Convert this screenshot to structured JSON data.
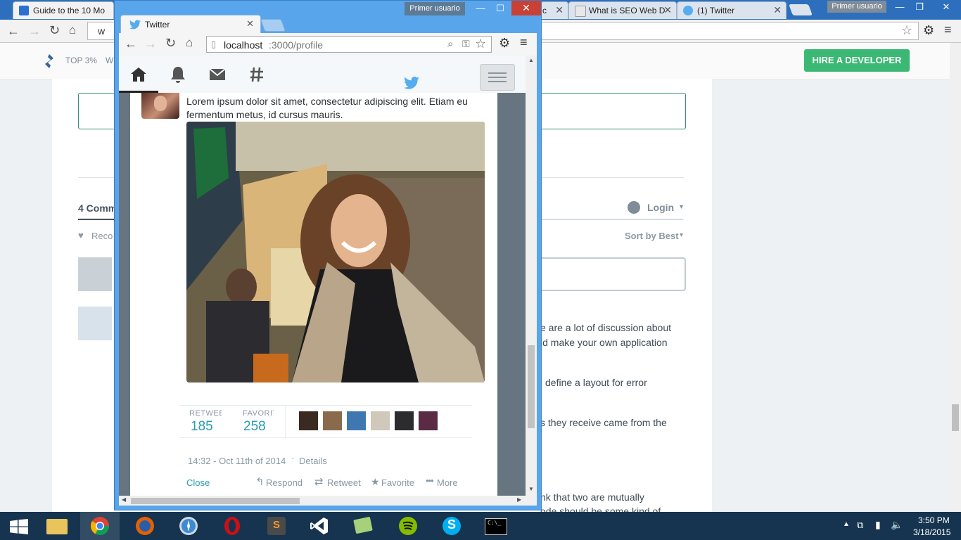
{
  "back_browser": {
    "tabs": [
      {
        "title": "Guide to the 10 Mo",
        "active": true
      },
      {
        "title": "c",
        "active": false
      },
      {
        "title": "What is SEO Web D",
        "active": false
      },
      {
        "title": "(1) Twitter",
        "active": false
      }
    ],
    "user_badge": "Primer usuario",
    "address": "w",
    "header": {
      "nav_top": "TOP 3%",
      "nav_partial": "W",
      "hire_button": "HIRE A DEVELOPER"
    },
    "comments": {
      "count_label": "4 Comm",
      "recommend": "Reco",
      "login": "Login",
      "sort": "Sort by Best",
      "snippets": [
        "e are a lot of discussion about",
        "ld make your own application",
        "define a layout for error",
        "s they receive came from the",
        "nk that two are mutually",
        "ode should be some kind of"
      ]
    }
  },
  "front_browser": {
    "user_badge": "Primer usuario",
    "tab_title": "Twitter",
    "url": {
      "host": "localhost",
      "path": ":3000/profile"
    },
    "tweet": {
      "text": "Lorem ipsum dolor sit amet, consectetur adipiscing elit. Etiam eu fermentum metus, id cursus mauris.",
      "stats": {
        "retweets_label": "RETWEETS",
        "retweets": "185",
        "favorites_label": "FAVORITES",
        "favorites": "258"
      },
      "timestamp": "14:32 - Oct 11th of 2014",
      "separator": "·",
      "details": "Details",
      "actions": {
        "close": "Close",
        "respond": "Respond",
        "retweet": "Retweet",
        "favorite": "Favorite",
        "more": "More"
      }
    }
  },
  "taskbar": {
    "apps": [
      "file-explorer",
      "chrome",
      "firefox",
      "safari",
      "opera",
      "sublime-text",
      "visual-studio",
      "file-viewer",
      "spotify",
      "skype",
      "command-prompt"
    ],
    "time": "3:50 PM",
    "date": "3/18/2015"
  },
  "colors": {
    "twitter_blue": "#55acee",
    "hire_green": "#3bb873",
    "stat_teal": "#2a9ab0",
    "taskbar": "#16344f"
  }
}
